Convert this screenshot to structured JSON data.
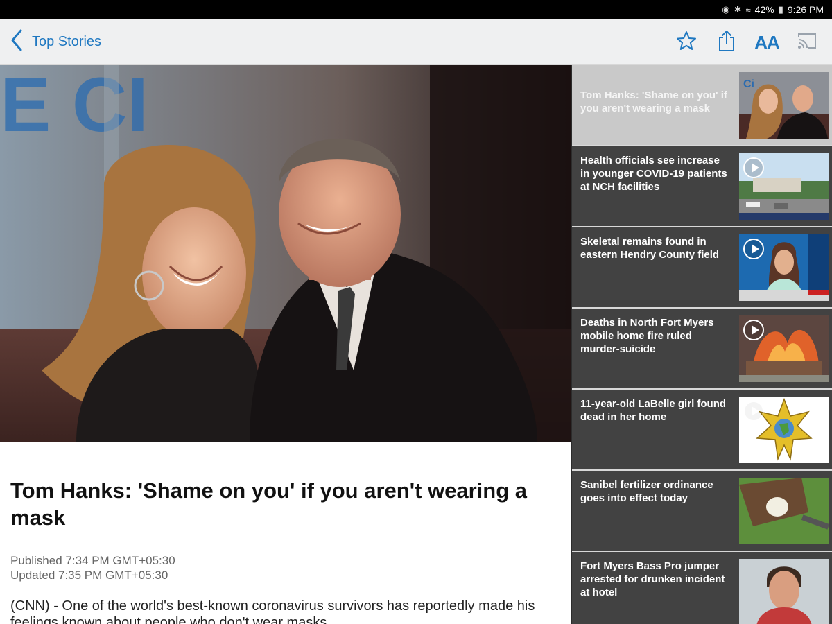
{
  "status_bar": {
    "battery": "42%",
    "time": "9:26 PM",
    "icons": [
      "location-icon",
      "bluetooth-icon",
      "wifi-icon",
      "battery-icon"
    ]
  },
  "toolbar": {
    "back_label": "Top Stories",
    "icons": [
      "chevron-left-icon",
      "star-icon",
      "share-icon",
      "text-size-icon",
      "cast-icon"
    ],
    "text_size_label": "AA"
  },
  "colors": {
    "accent": "#1f78c1",
    "sidebar_bg": "#424242",
    "active_story_bg": "#c9c9c9"
  },
  "article": {
    "headline": "Tom Hanks: 'Shame on you' if you aren't wearing a mask",
    "published": "Published 7:34 PM GMT+05:30",
    "updated": "Updated 7:35 PM GMT+05:30",
    "body": "(CNN) - One of the world's best-known coronavirus survivors has reportedly made his feelings known about people who don't wear masks."
  },
  "sidebar": {
    "stories": [
      {
        "title": "Tom Hanks: 'Shame on you' if you aren't wearing a mask",
        "has_video": false,
        "active": true
      },
      {
        "title": "Health officials see increase in younger COVID-19 patients at NCH facilities",
        "has_video": true,
        "active": false
      },
      {
        "title": "Skeletal remains found in eastern Hendry County field",
        "has_video": true,
        "active": false
      },
      {
        "title": "Deaths in North Fort Myers mobile home fire ruled murder-suicide",
        "has_video": true,
        "active": false
      },
      {
        "title": "11-year-old LaBelle girl found dead in her home",
        "has_video": true,
        "active": false
      },
      {
        "title": "Sanibel fertilizer ordinance goes into effect today",
        "has_video": false,
        "active": false
      },
      {
        "title": "Fort Myers Bass Pro jumper arrested for drunken incident at hotel",
        "has_video": false,
        "active": false
      }
    ]
  }
}
